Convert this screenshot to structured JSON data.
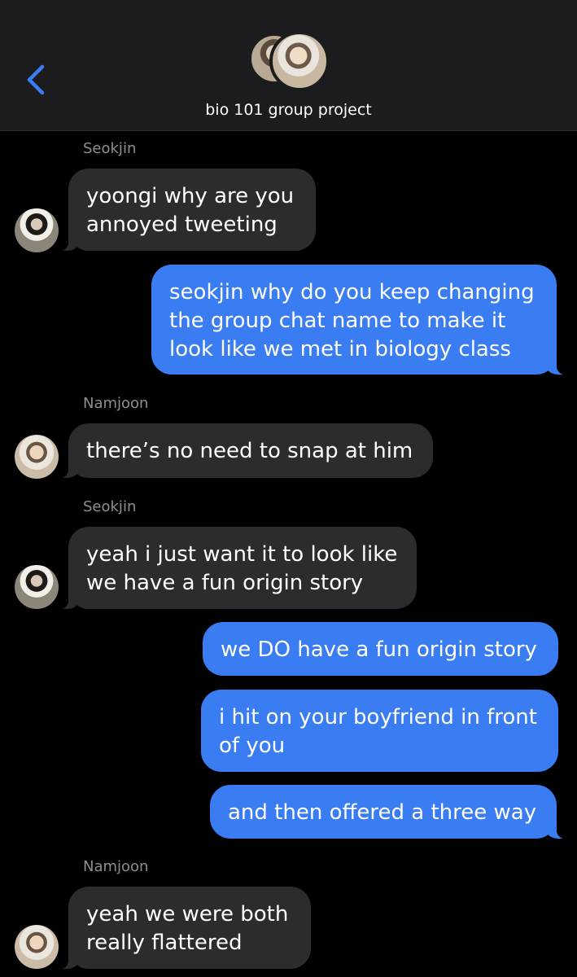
{
  "header": {
    "back_icon": "chevron-left-icon",
    "group_name": "bio 101 group project",
    "accent_color": "#3a7cf2"
  },
  "colors": {
    "background": "#000000",
    "header_background": "#1c1c1e",
    "incoming_bubble": "#2c2c2e",
    "outgoing_bubble": "#3a7cf2",
    "sender_label": "#8e8e93"
  },
  "messages": [
    {
      "direction": "incoming",
      "sender": "Seokjin",
      "lines": [
        "yoongi why are you",
        "annoyed tweeting"
      ]
    },
    {
      "direction": "outgoing",
      "lines": [
        "seokjin why do you keep changing",
        "the group chat name to make it",
        "look like we met in biology class"
      ]
    },
    {
      "direction": "incoming",
      "sender": "Namjoon",
      "lines": [
        "there’s no need to snap at him"
      ]
    },
    {
      "direction": "incoming",
      "sender": "Seokjin",
      "lines": [
        "yeah i just want it to look like",
        "we have a fun origin story"
      ]
    },
    {
      "direction": "outgoing",
      "lines": [
        "we DO have a fun origin story"
      ]
    },
    {
      "direction": "outgoing",
      "lines": [
        "i hit on your boyfriend in front",
        "of you"
      ]
    },
    {
      "direction": "outgoing",
      "lines": [
        "and then offered a three way"
      ]
    },
    {
      "direction": "incoming",
      "sender": "Namjoon",
      "lines": [
        "yeah we were both",
        "really flattered"
      ]
    }
  ]
}
